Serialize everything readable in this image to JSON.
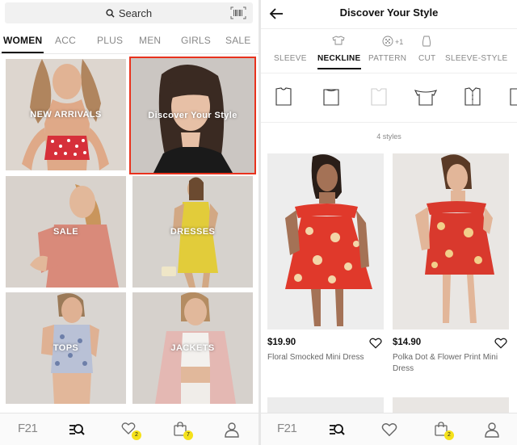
{
  "left": {
    "search": {
      "placeholder": "Search"
    },
    "tabs": [
      "WOMEN",
      "ACC",
      "PLUS",
      "MEN",
      "GIRLS",
      "SALE"
    ],
    "active_tab": "WOMEN",
    "tiles": [
      {
        "label": "NEW ARRIVALS"
      },
      {
        "label": "Discover Your Style"
      },
      {
        "label": "SALE"
      },
      {
        "label": "DRESSES"
      },
      {
        "label": "TOPS"
      },
      {
        "label": "JACKETS"
      }
    ],
    "nav": {
      "logo": "F21",
      "wishlist_badge": "2",
      "bag_badge": "7"
    }
  },
  "right": {
    "title": "Discover Your Style",
    "filters": [
      "SLEEVE",
      "NECKLINE",
      "PATTERN",
      "CUT",
      "SLEEVE-STYLE"
    ],
    "active_filter": "NECKLINE",
    "pattern_count": "+1",
    "styles_count": "4 styles",
    "products": [
      {
        "price": "$19.90",
        "name": "Floral Smocked Mini Dress"
      },
      {
        "price": "$14.90",
        "name": "Polka Dot & Flower Print Mini Dress"
      }
    ],
    "nav": {
      "logo": "F21",
      "bag_badge": "2"
    }
  },
  "colors": {
    "highlight": "#e8321d",
    "badge": "#f5e11a",
    "dress_red": "#e0392b"
  }
}
